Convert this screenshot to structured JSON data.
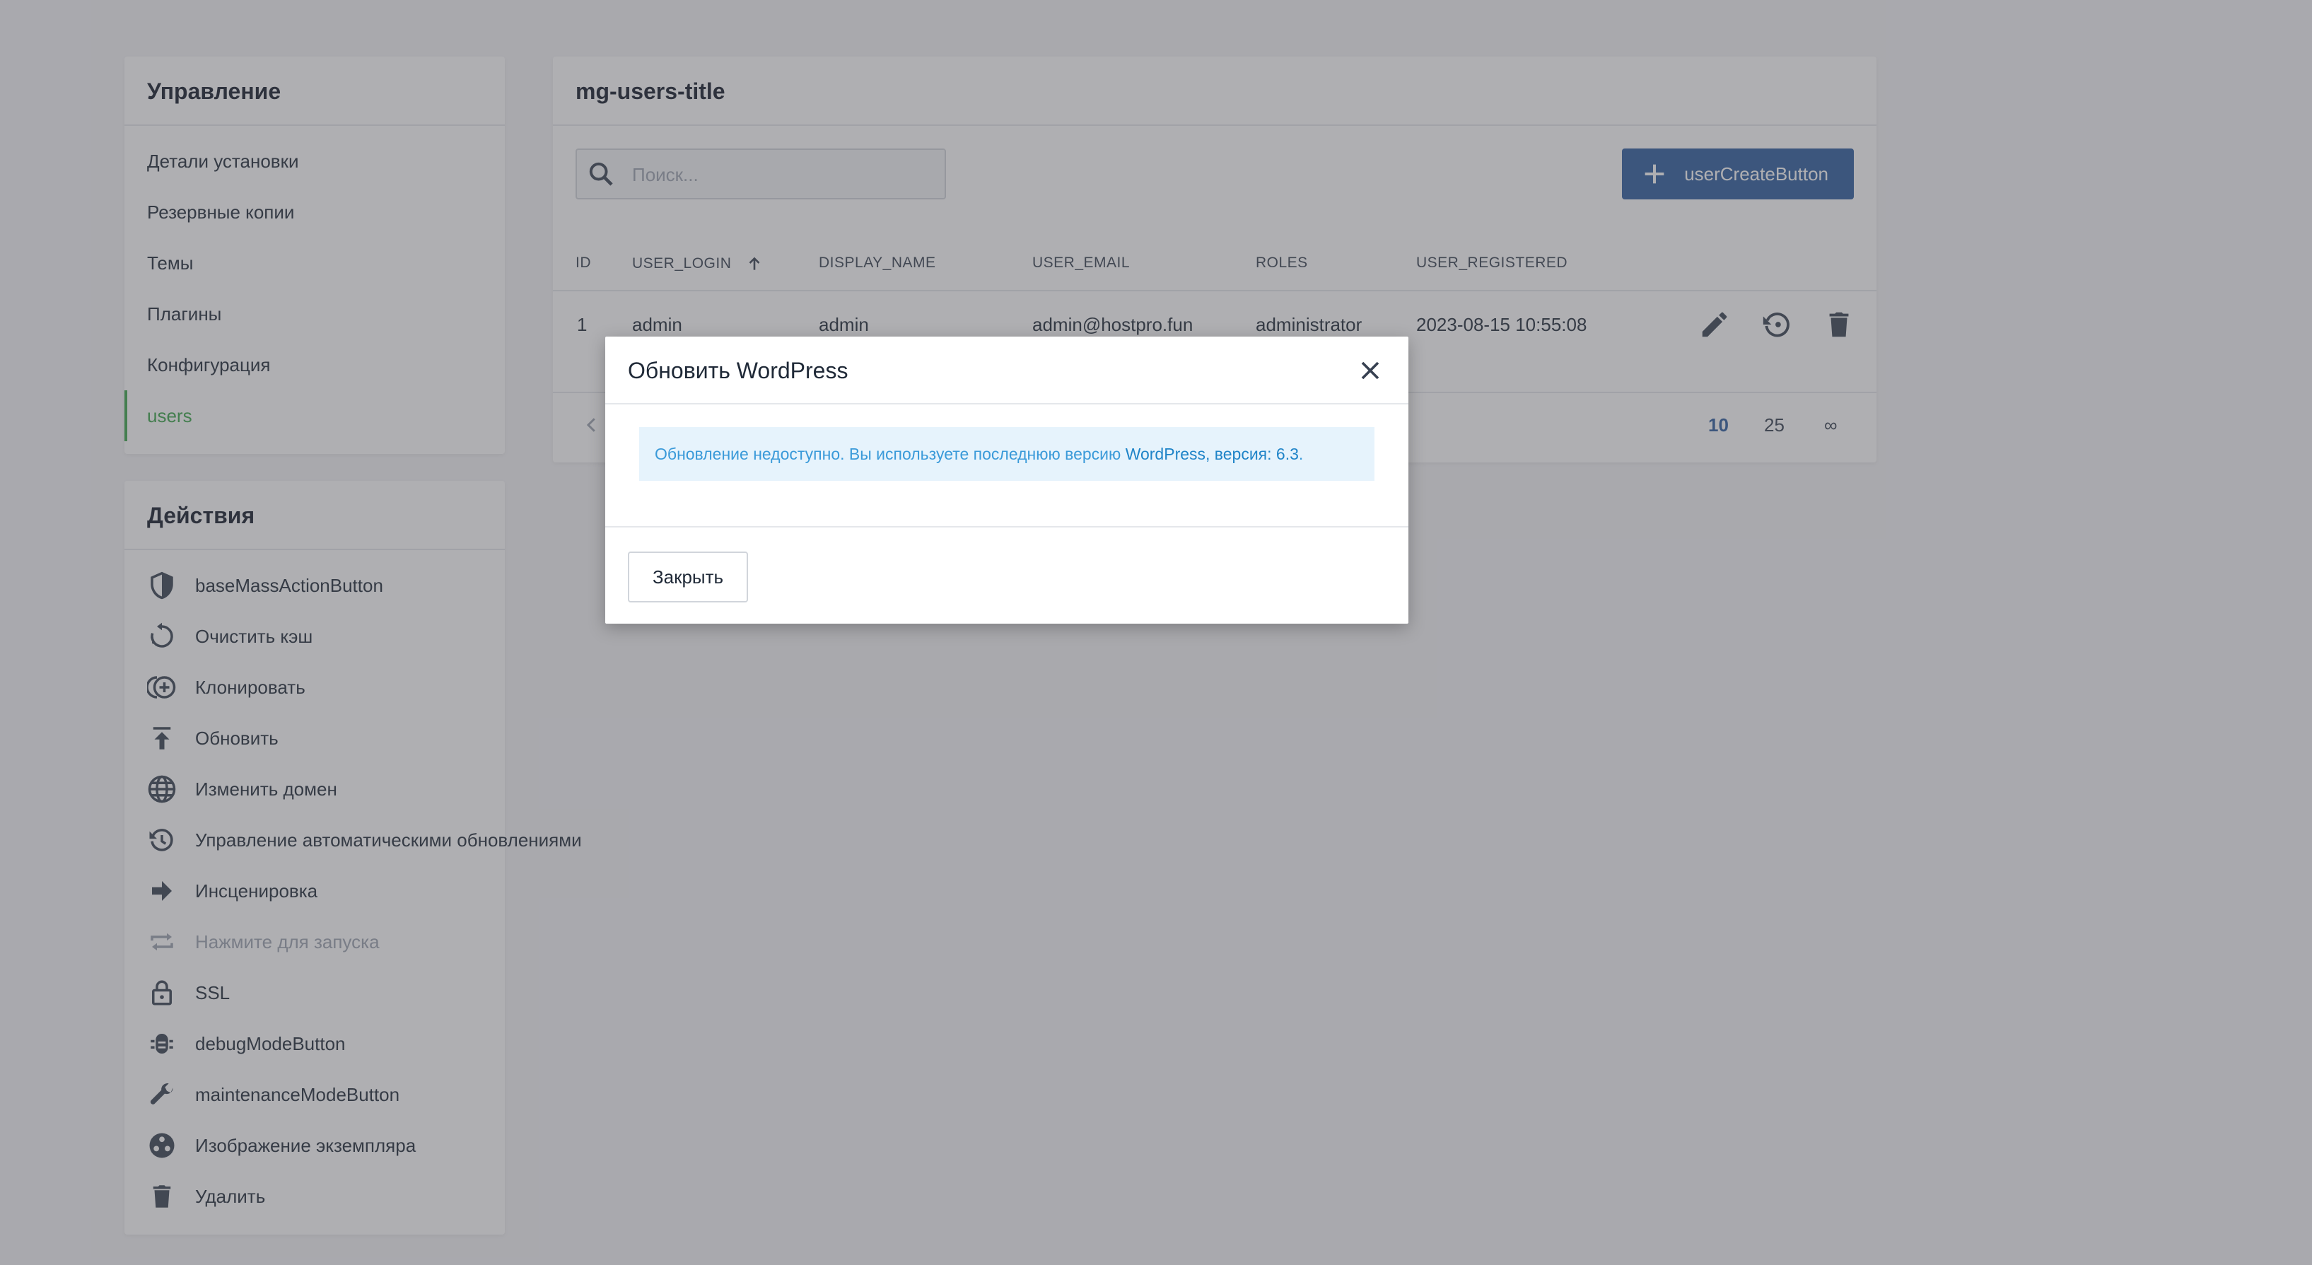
{
  "sidebar": {
    "title": "Управление",
    "items": [
      {
        "label": "Детали установки",
        "active": false
      },
      {
        "label": "Резервные копии",
        "active": false
      },
      {
        "label": "Темы",
        "active": false
      },
      {
        "label": "Плагины",
        "active": false
      },
      {
        "label": "Конфигурация",
        "active": false
      },
      {
        "label": "users",
        "active": true
      }
    ]
  },
  "actions": {
    "title": "Действия",
    "items": [
      {
        "label": "baseMassActionButton",
        "icon": "shield-icon"
      },
      {
        "label": "Очистить кэш",
        "icon": "clear-cache-icon"
      },
      {
        "label": "Клонировать",
        "icon": "clone-icon"
      },
      {
        "label": "Обновить",
        "icon": "upload-icon"
      },
      {
        "label": "Изменить домен",
        "icon": "globe-icon"
      },
      {
        "label": "Управление автоматическими обновлениями",
        "icon": "history-icon"
      },
      {
        "label": "Инсценировка",
        "icon": "arrow-right-icon"
      },
      {
        "label": "Нажмите для запуска",
        "icon": "repeat-icon",
        "disabled": true
      },
      {
        "label": "SSL",
        "icon": "lock-icon"
      },
      {
        "label": "debugModeButton",
        "icon": "bug-icon"
      },
      {
        "label": "maintenanceModeButton",
        "icon": "wrench-icon"
      },
      {
        "label": "Изображение экземпляра",
        "icon": "instance-image-icon"
      },
      {
        "label": "Удалить",
        "icon": "trash-icon"
      }
    ]
  },
  "users": {
    "title": "mg-users-title",
    "search_placeholder": "Поиск...",
    "create_button": "userCreateButton",
    "columns": [
      "ID",
      "USER_LOGIN",
      "DISPLAY_NAME",
      "USER_EMAIL",
      "ROLES",
      "USER_REGISTERED"
    ],
    "sorted_column": "USER_LOGIN",
    "rows": [
      {
        "id": "1",
        "login": "admin",
        "display_name": "admin",
        "email": "admin@hostpro.fun",
        "roles": "administrator",
        "registered": "2023-08-15 10:55:08"
      }
    ],
    "pagination": {
      "page_sizes": [
        "10",
        "25",
        "∞"
      ],
      "selected": "10"
    }
  },
  "modal": {
    "title": "Обновить WordPress",
    "message_prefix": "Обновление недоступно. Вы используете последнюю версию ",
    "message_highlight": "WordPress, версия: 6.3",
    "message_suffix": ".",
    "close_button": "Закрыть"
  },
  "colors": {
    "accent_green": "#3aa548",
    "primary_blue": "#2b5c9e",
    "info_bg": "#e6f3fc",
    "info_text": "#3a9ad9"
  }
}
